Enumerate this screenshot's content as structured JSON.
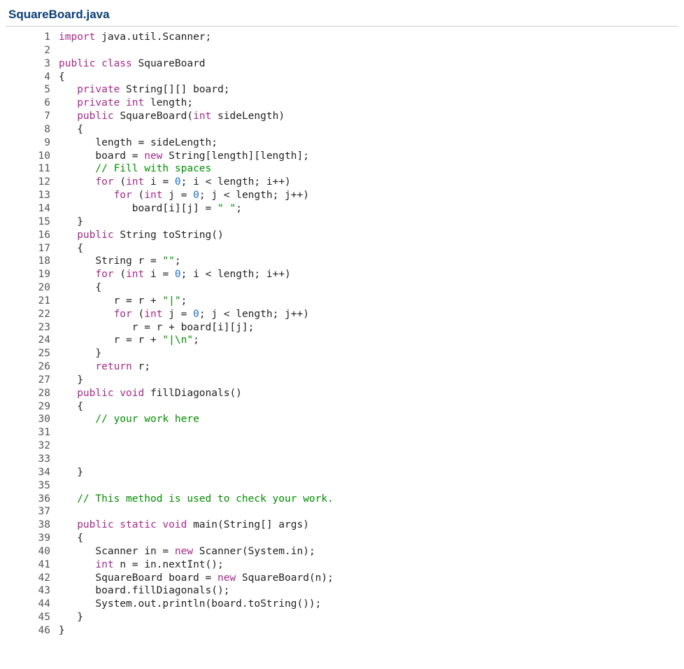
{
  "file_title": "SquareBoard.java",
  "line_numbers": [
    "1",
    "2",
    "3",
    "4",
    "5",
    "6",
    "7",
    "8",
    "9",
    "10",
    "11",
    "12",
    "13",
    "14",
    "15",
    "16",
    "17",
    "18",
    "19",
    "20",
    "21",
    "22",
    "23",
    "24",
    "25",
    "26",
    "27",
    "28",
    "29",
    "30",
    "31",
    "32",
    "33",
    "34",
    "35",
    "36",
    "37",
    "38",
    "39",
    "40",
    "41",
    "42",
    "43",
    "44",
    "45",
    "46"
  ],
  "code_lines": [
    [
      {
        "c": "kw",
        "t": "import"
      },
      {
        "t": " java.util.Scanner;"
      }
    ],
    [
      {
        "t": ""
      }
    ],
    [
      {
        "c": "kw",
        "t": "public class"
      },
      {
        "t": " SquareBoard"
      }
    ],
    [
      {
        "t": "{"
      }
    ],
    [
      {
        "t": "   "
      },
      {
        "c": "kw",
        "t": "private"
      },
      {
        "t": " String[][] board;"
      }
    ],
    [
      {
        "t": "   "
      },
      {
        "c": "kw",
        "t": "private int"
      },
      {
        "t": " length;"
      }
    ],
    [
      {
        "t": "   "
      },
      {
        "c": "kw",
        "t": "public"
      },
      {
        "t": " SquareBoard("
      },
      {
        "c": "kw",
        "t": "int"
      },
      {
        "t": " sideLength)"
      }
    ],
    [
      {
        "t": "   {"
      }
    ],
    [
      {
        "t": "      length = sideLength;"
      }
    ],
    [
      {
        "t": "      board = "
      },
      {
        "c": "kw",
        "t": "new"
      },
      {
        "t": " String[length][length];"
      }
    ],
    [
      {
        "t": "      "
      },
      {
        "c": "cmt",
        "t": "// Fill with spaces"
      }
    ],
    [
      {
        "t": "      "
      },
      {
        "c": "kw",
        "t": "for"
      },
      {
        "t": " ("
      },
      {
        "c": "kw",
        "t": "int"
      },
      {
        "t": " i = "
      },
      {
        "c": "num",
        "t": "0"
      },
      {
        "t": "; i < length; i++)"
      }
    ],
    [
      {
        "t": "         "
      },
      {
        "c": "kw",
        "t": "for"
      },
      {
        "t": " ("
      },
      {
        "c": "kw",
        "t": "int"
      },
      {
        "t": " j = "
      },
      {
        "c": "num",
        "t": "0"
      },
      {
        "t": "; j < length; j++)"
      }
    ],
    [
      {
        "t": "            board[i][j] = "
      },
      {
        "c": "str",
        "t": "\" \""
      },
      {
        "t": ";"
      }
    ],
    [
      {
        "t": "   }"
      }
    ],
    [
      {
        "t": "   "
      },
      {
        "c": "kw",
        "t": "public"
      },
      {
        "t": " String toString()"
      }
    ],
    [
      {
        "t": "   {"
      }
    ],
    [
      {
        "t": "      String r = "
      },
      {
        "c": "str",
        "t": "\"\""
      },
      {
        "t": ";"
      }
    ],
    [
      {
        "t": "      "
      },
      {
        "c": "kw",
        "t": "for"
      },
      {
        "t": " ("
      },
      {
        "c": "kw",
        "t": "int"
      },
      {
        "t": " i = "
      },
      {
        "c": "num",
        "t": "0"
      },
      {
        "t": "; i < length; i++)"
      }
    ],
    [
      {
        "t": "      {"
      }
    ],
    [
      {
        "t": "         r = r + "
      },
      {
        "c": "str",
        "t": "\"|\""
      },
      {
        "t": ";"
      }
    ],
    [
      {
        "t": "         "
      },
      {
        "c": "kw",
        "t": "for"
      },
      {
        "t": " ("
      },
      {
        "c": "kw",
        "t": "int"
      },
      {
        "t": " j = "
      },
      {
        "c": "num",
        "t": "0"
      },
      {
        "t": "; j < length; j++)"
      }
    ],
    [
      {
        "t": "            r = r + board[i][j];"
      }
    ],
    [
      {
        "t": "         r = r + "
      },
      {
        "c": "str",
        "t": "\"|\\n\""
      },
      {
        "t": ";"
      }
    ],
    [
      {
        "t": "      }"
      }
    ],
    [
      {
        "t": "      "
      },
      {
        "c": "kw",
        "t": "return"
      },
      {
        "t": " r;"
      }
    ],
    [
      {
        "t": "   }"
      }
    ],
    [
      {
        "t": "   "
      },
      {
        "c": "kw",
        "t": "public void"
      },
      {
        "t": " fillDiagonals()"
      }
    ],
    [
      {
        "t": "   {"
      }
    ],
    [
      {
        "t": "      "
      },
      {
        "c": "cmt",
        "t": "// your work here"
      }
    ],
    [
      {
        "t": ""
      }
    ],
    [
      {
        "t": ""
      }
    ],
    [
      {
        "t": ""
      }
    ],
    [
      {
        "t": "   }"
      }
    ],
    [
      {
        "t": ""
      }
    ],
    [
      {
        "t": "   "
      },
      {
        "c": "cmt",
        "t": "// This method is used to check your work."
      }
    ],
    [
      {
        "t": ""
      }
    ],
    [
      {
        "t": "   "
      },
      {
        "c": "kw",
        "t": "public static void"
      },
      {
        "t": " main(String[] args)"
      }
    ],
    [
      {
        "t": "   {"
      }
    ],
    [
      {
        "t": "      Scanner in = "
      },
      {
        "c": "kw",
        "t": "new"
      },
      {
        "t": " Scanner(System.in);"
      }
    ],
    [
      {
        "t": "      "
      },
      {
        "c": "kw",
        "t": "int"
      },
      {
        "t": " n = in.nextInt();"
      }
    ],
    [
      {
        "t": "      SquareBoard board = "
      },
      {
        "c": "kw",
        "t": "new"
      },
      {
        "t": " SquareBoard(n);"
      }
    ],
    [
      {
        "t": "      board.fillDiagonals();"
      }
    ],
    [
      {
        "t": "      System.out.println(board.toString());"
      }
    ],
    [
      {
        "t": "   }"
      }
    ],
    [
      {
        "t": "}"
      }
    ]
  ]
}
